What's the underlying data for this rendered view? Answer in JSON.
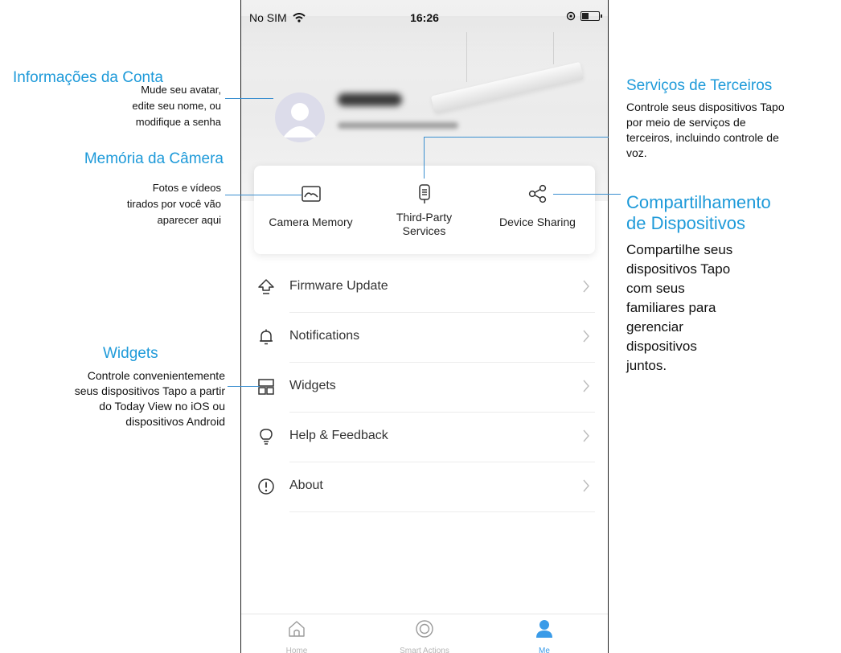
{
  "status_bar": {
    "carrier": "No SIM",
    "time": "16:26"
  },
  "card": [
    {
      "icon": "image-icon",
      "label": "Camera Memory"
    },
    {
      "icon": "remote-icon",
      "label": "Third-Party\nServices"
    },
    {
      "icon": "share-icon",
      "label": "Device Sharing"
    }
  ],
  "menu": [
    {
      "icon": "firmware-update-icon",
      "label": "Firmware Update"
    },
    {
      "icon": "bell-icon",
      "label": "Notifications"
    },
    {
      "icon": "widgets-icon",
      "label": "Widgets"
    },
    {
      "icon": "lightbulb-icon",
      "label": "Help & Feedback"
    },
    {
      "icon": "info-icon",
      "label": "About"
    }
  ],
  "tabs": [
    {
      "icon": "home-icon",
      "label": "Home"
    },
    {
      "icon": "smart-actions-icon",
      "label": "Smart Actions"
    },
    {
      "icon": "me-icon",
      "label": "Me"
    }
  ],
  "annotations": {
    "account": {
      "title": "Informações da Conta",
      "lines": [
        "Mude seu avatar,",
        "edite seu nome, ou",
        "modifique a senha"
      ]
    },
    "camera_memory": {
      "title": "Memória da Câmera",
      "lines": [
        "Fotos e vídeos",
        "tirados por você vão",
        "aparecer aqui"
      ]
    },
    "widgets": {
      "title": "Widgets",
      "lines": [
        "Controle convenientemente",
        "seus dispositivos Tapo a partir",
        "do Today View no iOS ou",
        "dispositivos Android"
      ]
    },
    "third_party": {
      "title": "Serviços de Terceiros",
      "lines": [
        "Controle seus dispositivos Tapo",
        "por meio de serviços de",
        "terceiros, incluindo controle de",
        "voz."
      ]
    },
    "sharing": {
      "title_lines": [
        "Compartilhamento",
        "de Dispositivos"
      ],
      "lines": [
        "Compartilhe seus",
        "dispositivos Tapo",
        "com seus",
        "familiares para",
        "gerenciar",
        "dispositivos",
        "juntos."
      ]
    }
  }
}
